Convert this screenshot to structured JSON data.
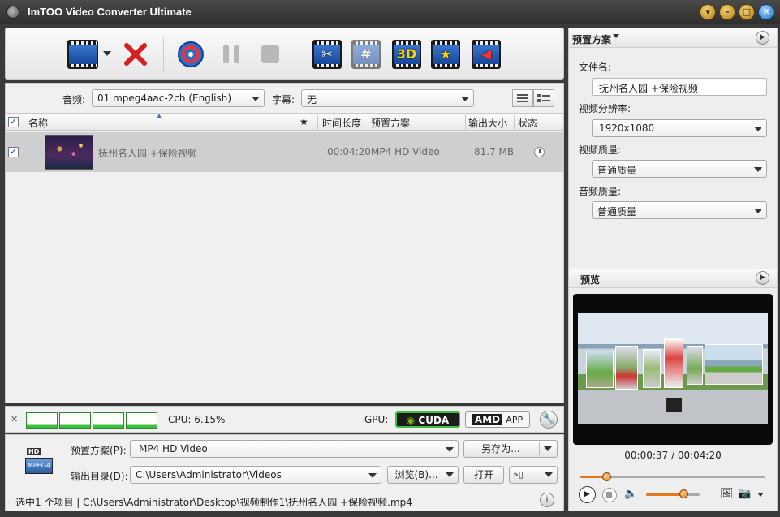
{
  "app": {
    "title": "ImTOO Video Converter Ultimate"
  },
  "audio_bar": {
    "audio_label": "音频:",
    "audio_value": "01 mpeg4aac-2ch (English)",
    "subtitle_label": "字幕:",
    "subtitle_value": "无"
  },
  "columns": {
    "name": "名称",
    "duration": "时间长度",
    "profile": "预置方案",
    "size": "输出大小",
    "status": "状态"
  },
  "files": [
    {
      "name": "抚州名人园 +保险视频",
      "duration": "00:04:20",
      "profile": "MP4 HD Video",
      "size": "81.7 MB",
      "checked": true
    }
  ],
  "status_strip": {
    "cpu": "CPU: 6.15%",
    "gpu_label": "GPU:",
    "cuda": "CUDA",
    "amd": "AMD",
    "app": "APP"
  },
  "output": {
    "profile_label": "预置方案(P):",
    "profile_value": "MP4 HD Video",
    "save_as": "另存为...",
    "dir_label": "输出目录(D):",
    "dir_value": "C:\\Users\\Administrator\\Videos",
    "browse": "浏览(B)...",
    "open": "打开",
    "hd_badge": "HD",
    "codec_badge": "MPEG4"
  },
  "statusbar": {
    "text": "选中1 个项目 | C:\\Users\\Administrator\\Desktop\\视频制作1\\抚州名人园 +保险视频.mp4"
  },
  "right": {
    "profile_header": "预置方案",
    "filename_label": "文件名:",
    "filename_value": "抚州名人园 +保险视频",
    "resolution_label": "视频分辨率:",
    "resolution_value": "1920x1080",
    "video_quality_label": "视频质量:",
    "video_quality_value": "普通质量",
    "audio_quality_label": "音频质量:",
    "audio_quality_value": "普通质量",
    "preview_header": "预览",
    "time": "00:00:37 / 00:04:20",
    "progress": 0.14,
    "volume": 0.7
  },
  "colors": {
    "accent": "#e0791a",
    "selected_row": "#cfcfcf",
    "gpu_green": "#3fbf3f"
  }
}
